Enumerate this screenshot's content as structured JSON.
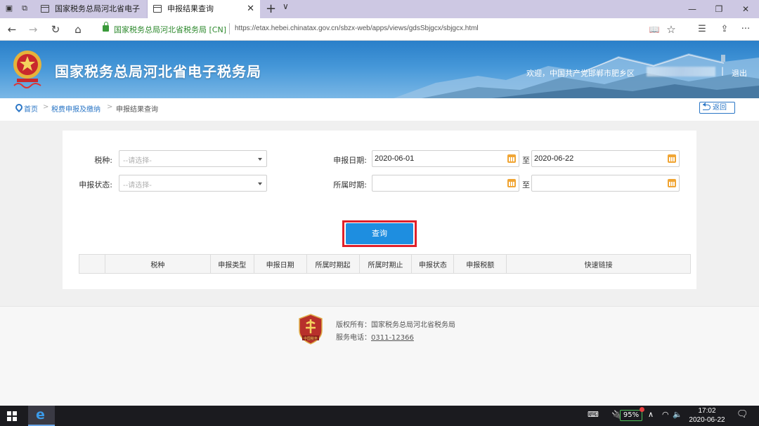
{
  "browser": {
    "tabs": [
      {
        "label": "国家税务总局河北省电子税"
      },
      {
        "label": "申报结果查询",
        "close": "✕"
      }
    ],
    "new_tab": "+",
    "tab_menu": "∨",
    "window_controls": {
      "minimize": "—",
      "restore": "❐",
      "close": "✕"
    },
    "nav": {
      "back": "←",
      "forward": "→",
      "refresh": "↻",
      "home": "⌂"
    },
    "cert_name": "国家税务总局河北省税务局 [CN]",
    "url": "https://etax.hebei.chinatax.gov.cn/sbzx-web/apps/views/gdsSbjgcx/sbjgcx.html",
    "addr_icons": {
      "reading": "📖",
      "favorite": "☆",
      "favorites_list": "☰",
      "share": "⇪",
      "more": "···"
    }
  },
  "site": {
    "title": "国家税务总局河北省电子税务局",
    "welcome": "欢迎，中国共产党邯郸市肥乡区",
    "header_sep": "|",
    "logout": "退出",
    "colors": {
      "header_blue": "#2a7fc9",
      "query_blue": "#1e8ee0",
      "highlight_red": "#e0202a",
      "calendar_orange": "#f0a534"
    }
  },
  "breadcrumb": {
    "home": "首页",
    "sep1": ">",
    "level2": "税费申报及缴纳",
    "sep2": ">",
    "current": "申报结果查询",
    "back": "返回"
  },
  "form": {
    "tax_type": {
      "label": "税种:",
      "placeholder": "--请选择-"
    },
    "decl_status": {
      "label": "申报状态:",
      "placeholder": "--请选择-"
    },
    "decl_date": {
      "label": "申报日期:",
      "from": "2020-06-01",
      "to_label": "至",
      "to": "2020-06-22"
    },
    "period": {
      "label": "所属时期:",
      "from": "",
      "to_label": "至",
      "to": ""
    },
    "query_button": "查询"
  },
  "table": {
    "columns": [
      "",
      "税种",
      "申报类型",
      "申报日期",
      "所属时期起",
      "所属时期止",
      "申报状态",
      "申报税额",
      "快速链接"
    ]
  },
  "footer": {
    "badge_text": "中国税务",
    "copyright": "版权所有：国家税务总局河北省税务局",
    "phone_label": "服务电话：",
    "phone": "0311-12366"
  },
  "taskbar": {
    "battery": "95%",
    "time": "17:02",
    "date": "2020-06-22",
    "tray": {
      "keyboard": "⌨",
      "arrow": "∧",
      "volume": "🔈",
      "notifications": "🗨"
    }
  }
}
